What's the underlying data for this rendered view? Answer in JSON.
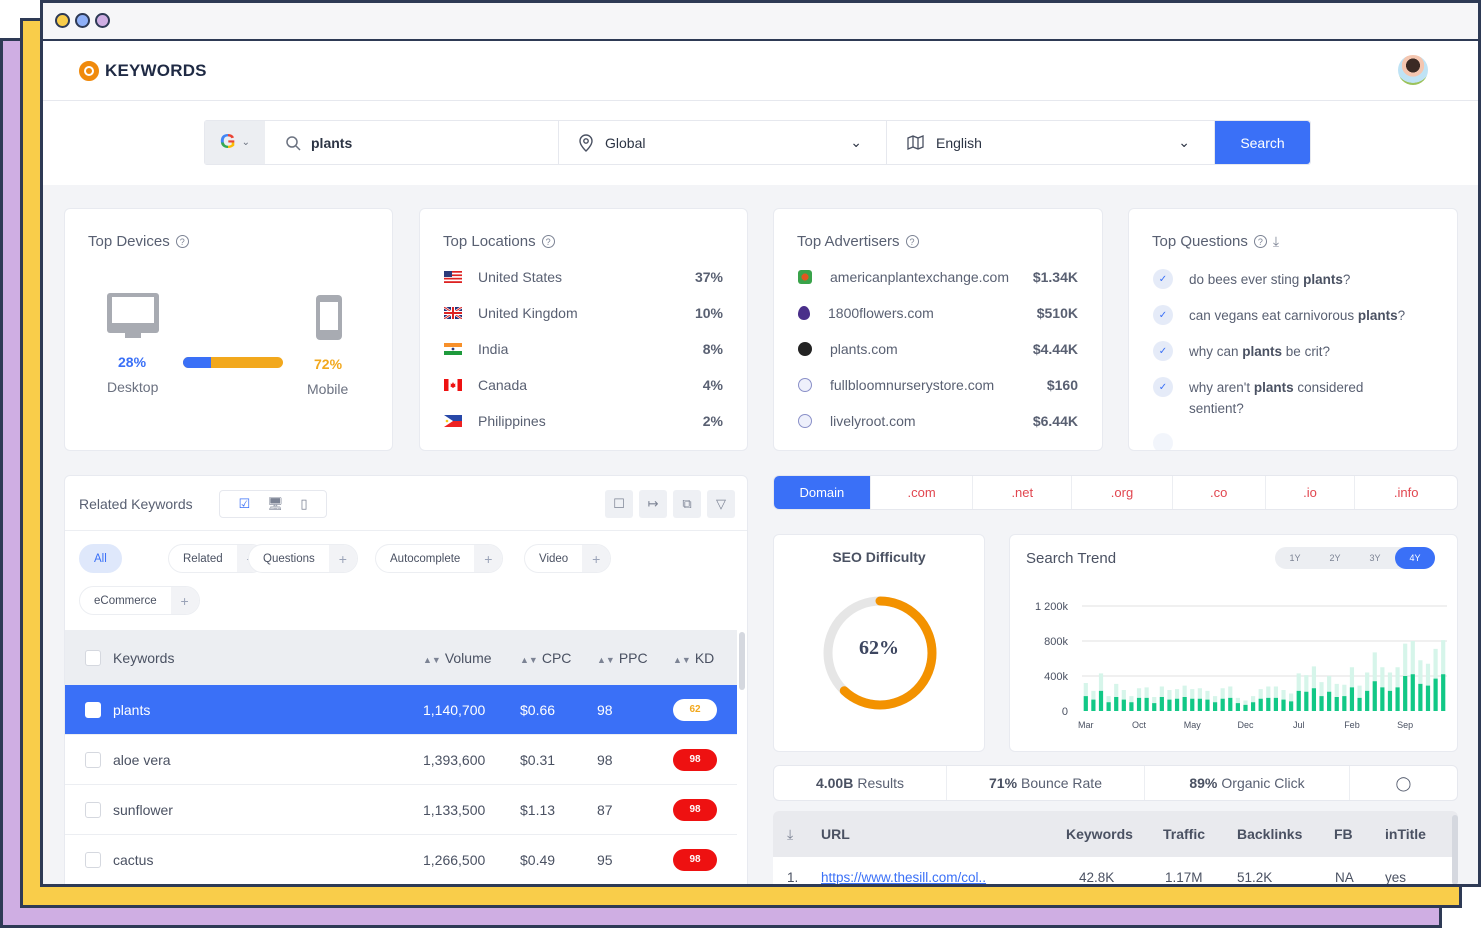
{
  "app": {
    "name": "KEYWORDS"
  },
  "search": {
    "engine": "Google",
    "engine_icon": "google-logo",
    "keyword": "plants",
    "location": "Global",
    "language": "English",
    "button_label": "Search"
  },
  "top_devices": {
    "title": "Top Devices",
    "desktop": {
      "label": "Desktop",
      "percent": "28%",
      "share": 0.28,
      "color": "#3a70f7"
    },
    "mobile": {
      "label": "Mobile",
      "percent": "72%",
      "share": 0.72,
      "color": "#f2a81d"
    }
  },
  "top_locations": {
    "title": "Top Locations",
    "items": [
      {
        "country": "United States",
        "value": "37%",
        "flag": "us"
      },
      {
        "country": "United Kingdom",
        "value": "10%",
        "flag": "gb"
      },
      {
        "country": "India",
        "value": "8%",
        "flag": "in"
      },
      {
        "country": "Canada",
        "value": "4%",
        "flag": "ca"
      },
      {
        "country": "Philippines",
        "value": "2%",
        "flag": "ph"
      }
    ]
  },
  "top_advertisers": {
    "title": "Top Advertisers",
    "items": [
      {
        "domain": "americanplantexchange.com",
        "value": "$1.34K",
        "icon": "plant-favicon"
      },
      {
        "domain": "1800flowers.com",
        "value": "$510K",
        "icon": "flower-favicon"
      },
      {
        "domain": "plants.com",
        "value": "$4.44K",
        "icon": "plants-favicon"
      },
      {
        "domain": "fullbloomnurserystore.com",
        "value": "$160",
        "icon": "globe-icon"
      },
      {
        "domain": "livelyroot.com",
        "value": "$6.44K",
        "icon": "globe-icon"
      }
    ]
  },
  "top_questions": {
    "title": "Top Questions",
    "items": [
      {
        "before": "do bees ever sting ",
        "bold": "plants",
        "after": "?"
      },
      {
        "before": "can vegans eat carnivorous ",
        "bold": "plants",
        "after": "?"
      },
      {
        "before": "why can ",
        "bold": "plants",
        "after": " be crit?"
      },
      {
        "before": "why aren't ",
        "bold": "plants",
        "after": " considered sentient?"
      }
    ]
  },
  "related_keywords": {
    "title": "Related Keywords",
    "filters": [
      {
        "label": "All",
        "active": true
      },
      {
        "label": "Related"
      },
      {
        "label": "Questions"
      },
      {
        "label": "Autocomplete"
      },
      {
        "label": "Video"
      },
      {
        "label": "eCommerce"
      }
    ],
    "columns": [
      "Keywords",
      "Volume",
      "CPC",
      "PPC",
      "KD"
    ],
    "rows": [
      {
        "keyword": "plants",
        "volume": "1,140,700",
        "cpc": "$0.66",
        "ppc": "98",
        "kd": "62",
        "selected": true
      },
      {
        "keyword": "aloe vera",
        "volume": "1,393,600",
        "cpc": "$0.31",
        "ppc": "98",
        "kd": "98"
      },
      {
        "keyword": "sunflower",
        "volume": "1,133,500",
        "cpc": "$1.13",
        "ppc": "87",
        "kd": "98"
      },
      {
        "keyword": "cactus",
        "volume": "1,266,500",
        "cpc": "$0.49",
        "ppc": "95",
        "kd": "98"
      }
    ]
  },
  "domain_tabs": [
    "Domain",
    ".com",
    ".net",
    ".org",
    ".co",
    ".io",
    ".info"
  ],
  "seo_difficulty": {
    "title": "SEO Difficulty",
    "value": 62,
    "label": "62%",
    "color": "#f39200"
  },
  "search_trend": {
    "title": "Search Trend",
    "ranges": [
      "1Y",
      "2Y",
      "3Y",
      "4Y"
    ],
    "active_range": "4Y"
  },
  "stats": {
    "results": {
      "value": "4.00B",
      "label": "Results"
    },
    "bounce": {
      "value": "71%",
      "label": "Bounce Rate"
    },
    "organic": {
      "value": "89%",
      "label": "Organic Click"
    }
  },
  "serp": {
    "columns": [
      "URL",
      "Keywords",
      "Traffic",
      "Backlinks",
      "FB",
      "inTitle"
    ],
    "rows": [
      {
        "rank": "1.",
        "url": "https://www.thesill.com/col..",
        "keywords": "42.8K",
        "traffic": "1.17M",
        "backlinks": "51.2K",
        "fb": "NA",
        "intitle": "yes"
      }
    ]
  },
  "chart_data": {
    "type": "bar",
    "title": "Search Trend",
    "xlabel": "",
    "ylabel": "",
    "ylim": [
      0,
      1200000
    ],
    "yticks": [
      "0",
      "400k",
      "800k",
      "1 200k"
    ],
    "ytick_values": [
      0,
      400000,
      800000,
      1200000
    ],
    "xtick_labels": [
      "Mar",
      "Oct",
      "May",
      "Dec",
      "Jul",
      "Feb",
      "Sep"
    ],
    "xtick_index": [
      0,
      7,
      14,
      21,
      28,
      35,
      42
    ],
    "grid": true,
    "legend": "none",
    "series": [
      {
        "name": "total",
        "color": "#d6f5ea",
        "values": [
          320000,
          230000,
          430000,
          170000,
          310000,
          240000,
          170000,
          260000,
          270000,
          160000,
          280000,
          240000,
          250000,
          290000,
          250000,
          260000,
          230000,
          170000,
          260000,
          280000,
          150000,
          120000,
          170000,
          250000,
          280000,
          280000,
          240000,
          200000,
          430000,
          410000,
          510000,
          330000,
          400000,
          310000,
          300000,
          500000,
          290000,
          440000,
          670000,
          500000,
          440000,
          500000,
          770000,
          800000,
          580000,
          540000,
          710000,
          810000
        ]
      },
      {
        "name": "primary",
        "color": "#12c886",
        "values": [
          170000,
          130000,
          230000,
          100000,
          160000,
          130000,
          100000,
          150000,
          150000,
          90000,
          160000,
          130000,
          140000,
          160000,
          140000,
          140000,
          130000,
          100000,
          140000,
          150000,
          90000,
          70000,
          100000,
          140000,
          150000,
          150000,
          130000,
          110000,
          230000,
          220000,
          260000,
          170000,
          220000,
          160000,
          170000,
          270000,
          150000,
          230000,
          340000,
          270000,
          230000,
          270000,
          400000,
          420000,
          310000,
          290000,
          370000,
          420000
        ]
      }
    ]
  }
}
